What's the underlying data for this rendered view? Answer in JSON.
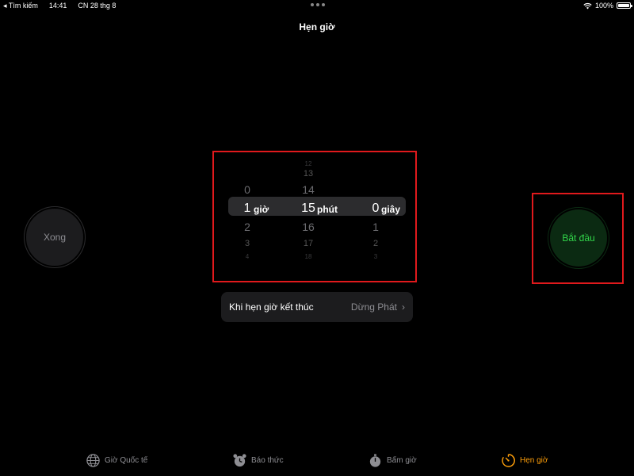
{
  "status_bar": {
    "back_app": "◂ Tìm kiếm",
    "time": "14:41",
    "date": "CN 28 thg 8",
    "battery": "100%"
  },
  "page": {
    "title": "Hẹn giờ"
  },
  "buttons": {
    "cancel_label": "Xong",
    "start_label": "Bắt đầu"
  },
  "picker": {
    "hours": {
      "above": [
        "0"
      ],
      "selected": "1",
      "unit": "giờ",
      "below": [
        "2",
        "3",
        "4"
      ]
    },
    "minutes": {
      "above": [
        "12",
        "13",
        "14"
      ],
      "selected": "15",
      "unit": "phút",
      "below": [
        "16",
        "17",
        "18"
      ]
    },
    "seconds": {
      "selected": "0",
      "unit": "giây",
      "below": [
        "1",
        "2",
        "3"
      ]
    }
  },
  "timer_end": {
    "label": "Khi hẹn giờ kết thúc",
    "value": "Dừng Phát"
  },
  "tabs": [
    {
      "label": "Giờ Quốc tế",
      "icon": "globe-icon",
      "active": false
    },
    {
      "label": "Báo thức",
      "icon": "alarm-clock-icon",
      "active": false
    },
    {
      "label": "Bấm giờ",
      "icon": "stopwatch-icon",
      "active": false
    },
    {
      "label": "Hẹn giờ",
      "icon": "timer-icon",
      "active": true
    }
  ],
  "colors": {
    "accent_active_tab": "#ff9f0a",
    "start_green": "#32d74b",
    "highlight_red": "#e0191c"
  }
}
